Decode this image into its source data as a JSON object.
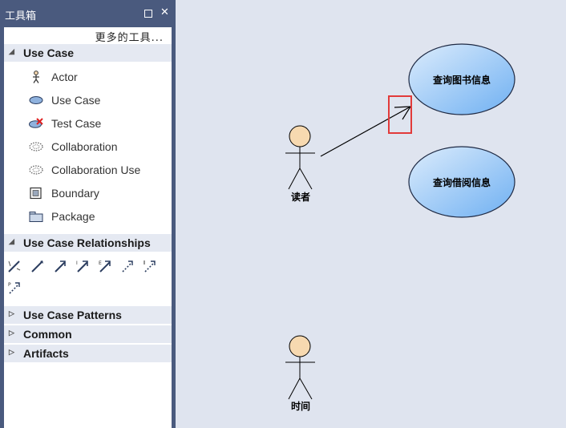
{
  "toolbox": {
    "title": "工具箱",
    "more_tools": "更多的工具...",
    "categories": {
      "use_case": {
        "label": "Use Case",
        "items": [
          {
            "label": "Actor",
            "icon": "actor-icon"
          },
          {
            "label": "Use Case",
            "icon": "use-case-icon"
          },
          {
            "label": "Test Case",
            "icon": "test-case-icon"
          },
          {
            "label": "Collaboration",
            "icon": "collaboration-icon"
          },
          {
            "label": "Collaboration Use",
            "icon": "collaboration-use-icon"
          },
          {
            "label": "Boundary",
            "icon": "boundary-icon"
          },
          {
            "label": "Package",
            "icon": "package-icon"
          }
        ]
      },
      "relationships": {
        "label": "Use Case Relationships",
        "icons": [
          "association-icon",
          "generalization-icon",
          "include-icon",
          "extend-icon",
          "realize-icon",
          "dependency-icon",
          "trace-icon",
          "package-import-icon"
        ]
      },
      "patterns": {
        "label": "Use Case Patterns"
      },
      "common": {
        "label": "Common"
      },
      "artifacts": {
        "label": "Artifacts"
      }
    }
  },
  "diagram": {
    "use_cases": [
      {
        "label": "查询图书信息"
      },
      {
        "label": "查询借阅信息"
      }
    ],
    "actors": [
      {
        "label": "读者"
      },
      {
        "label": "时间"
      }
    ]
  },
  "colors": {
    "panel_frame": "#4a5a7e",
    "category_bg": "#e5e9f2",
    "canvas_bg": "#dfe4ef",
    "actor_head": "#f7d9b0",
    "highlight": "#e23a3a"
  }
}
